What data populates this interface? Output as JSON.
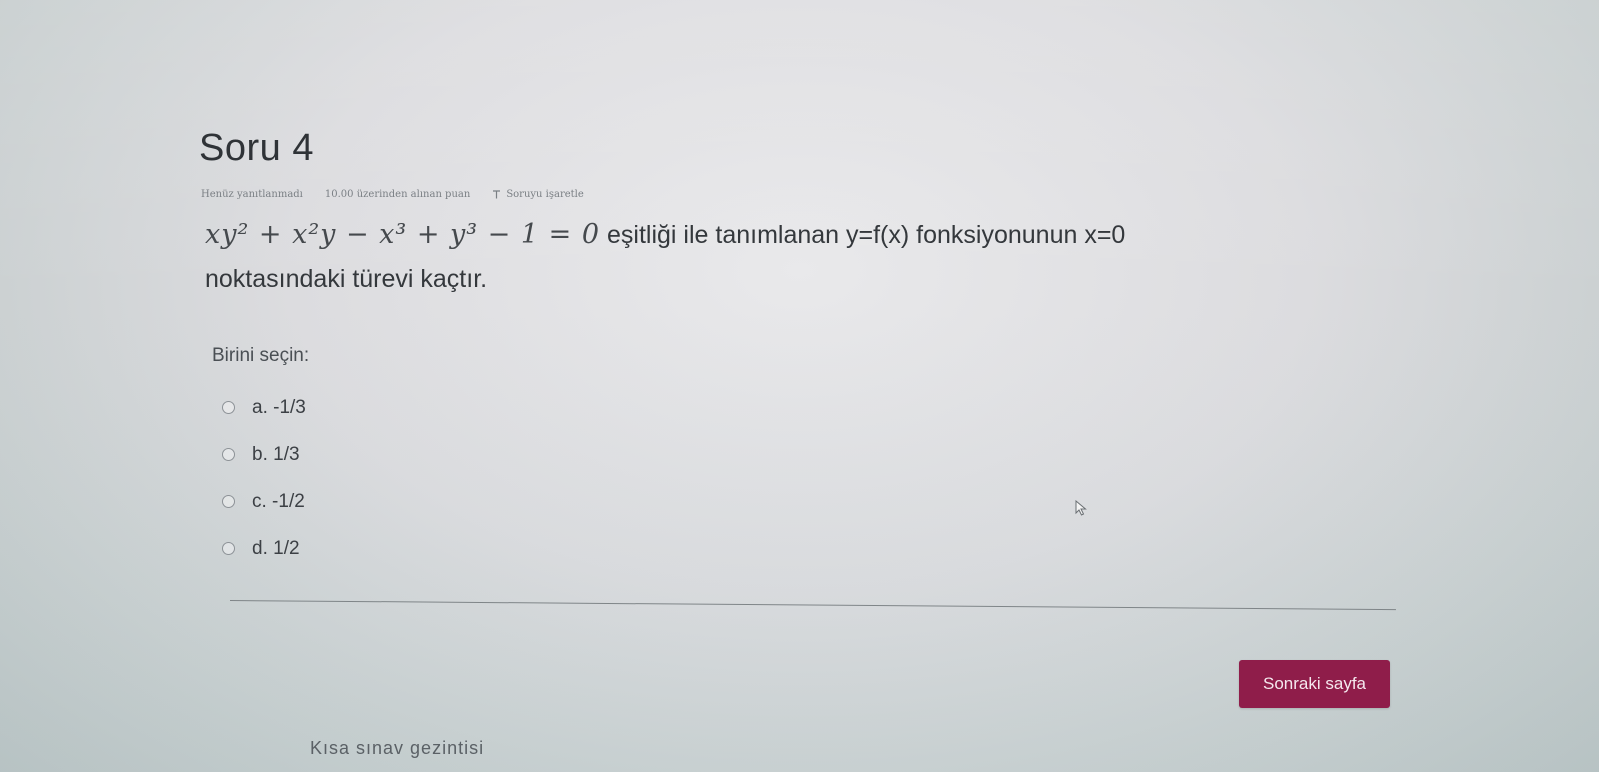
{
  "question": {
    "title": "Soru 4",
    "status": "Henüz yanıtlanmadı",
    "marks": "10.00 üzerinden alınan puan",
    "flag_label": "Soruyu işaretle",
    "equation": "xy² + x²y − x³ + y³ − 1 = 0",
    "text_after_equation": " eşitliği ile tanımlanan y=f(x) fonksiyonunun x=0",
    "text_line2": "noktasındaki türevi kaçtır."
  },
  "answer": {
    "prompt": "Birini seçin:",
    "options": [
      {
        "label": "a. -1/3"
      },
      {
        "label": "b. 1/3"
      },
      {
        "label": "c. -1/2"
      },
      {
        "label": "d. 1/2"
      }
    ]
  },
  "navigation": {
    "next_button": "Sonraki sayfa",
    "quiz_nav_title": "Kısa sınav gezintisi"
  },
  "colors": {
    "accent": "#8f1d4a"
  },
  "icons": {
    "flag": "flag-icon",
    "cursor": "mouse-pointer-icon"
  }
}
